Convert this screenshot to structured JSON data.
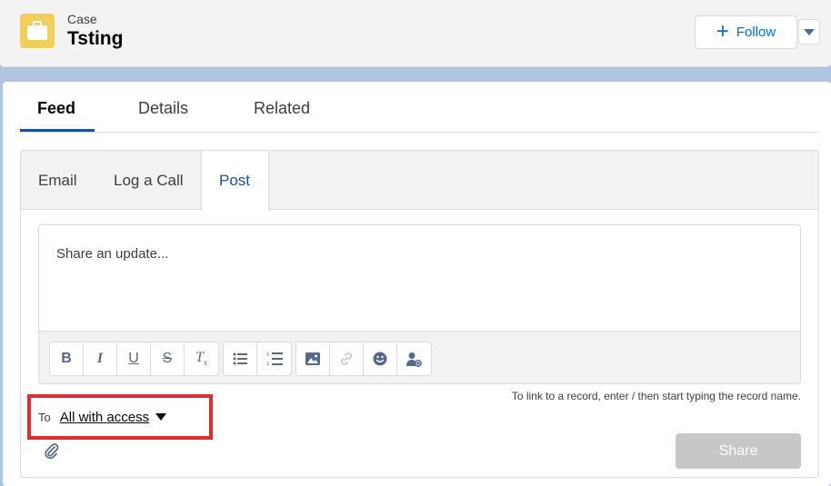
{
  "header": {
    "object_label": "Case",
    "record_title": "Tsting",
    "follow_label": "Follow",
    "icon": "case-briefcase-icon"
  },
  "tabs": [
    {
      "label": "Feed",
      "active": true
    },
    {
      "label": "Details",
      "active": false
    },
    {
      "label": "Related",
      "active": false
    }
  ],
  "publisher": {
    "tabs": [
      {
        "label": "Email",
        "active": false
      },
      {
        "label": "Log a Call",
        "active": false
      },
      {
        "label": "Post",
        "active": true
      }
    ],
    "placeholder": "Share an update...",
    "toolbar": [
      "bold-icon",
      "italic-icon",
      "underline-icon",
      "strikethrough-icon",
      "clear-format-icon",
      "bulleted-list-icon",
      "numbered-list-icon",
      "image-icon",
      "link-icon",
      "emoji-icon",
      "mention-user-icon"
    ],
    "hint": "To link to a record, enter / then start typing the record name.",
    "to_label": "To",
    "audience": "All with access",
    "share_label": "Share"
  },
  "colors": {
    "accent": "#0070d2",
    "active_tab": "#1b5297",
    "case_icon_bg": "#f2cf5b",
    "highlight": "#e22d2f",
    "share_disabled": "#c9c7c5"
  }
}
